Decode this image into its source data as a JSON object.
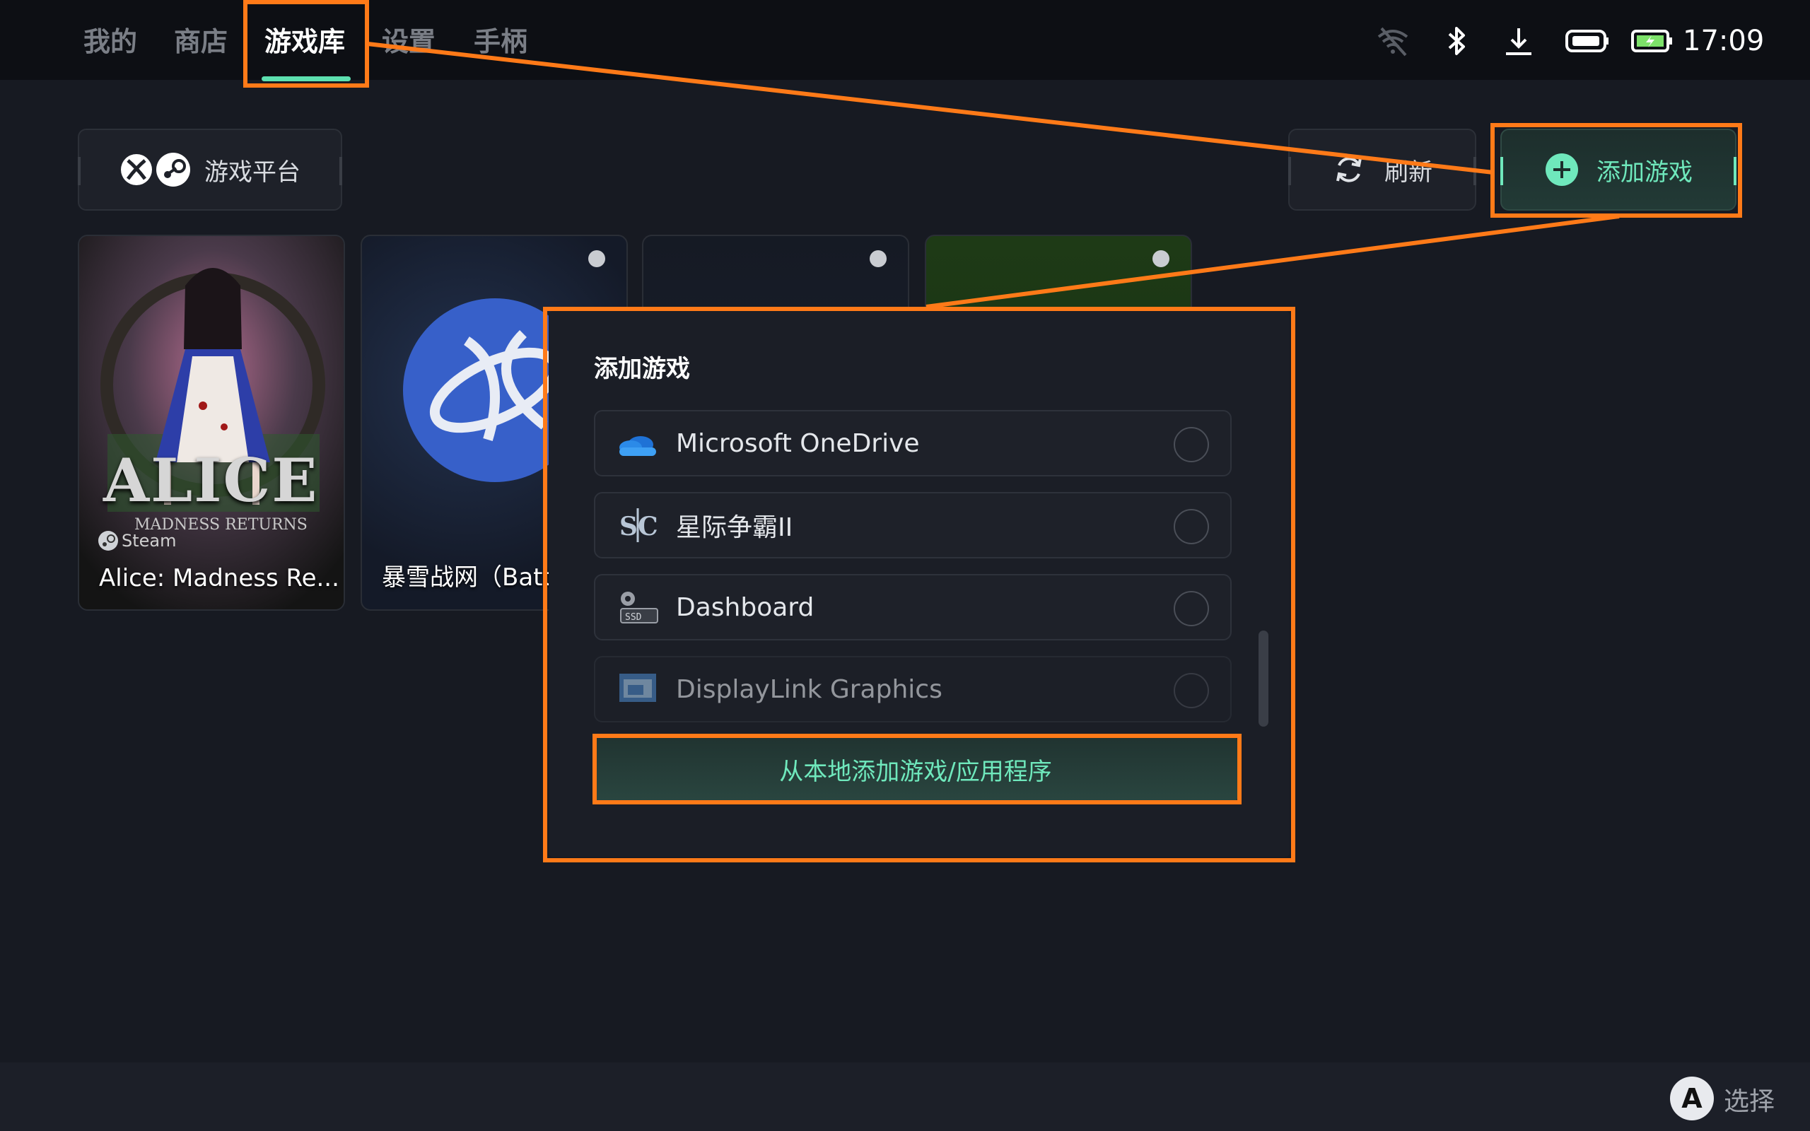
{
  "nav": {
    "tabs": [
      "我的",
      "商店",
      "游戏库",
      "设置",
      "手柄"
    ],
    "active_tab": "游戏库"
  },
  "status": {
    "icons": [
      "wifi-off-icon",
      "bluetooth-icon",
      "download-icon",
      "controller-battery-icon",
      "battery-charging-icon"
    ],
    "time": "17:09"
  },
  "toolbar": {
    "platform_label": "游戏平台",
    "refresh_label": "刷新",
    "add_game_label": "添加游戏"
  },
  "games": [
    {
      "title": "Alice: Madness Re...",
      "art_text": "ALICE",
      "art_subtext": "MADNESS RETURNS",
      "source": "Steam"
    },
    {
      "title": "暴雪战网（Battle.net）"
    },
    {
      "title": ""
    },
    {
      "title": ""
    }
  ],
  "modal": {
    "title": "添加游戏",
    "options": [
      {
        "label": "Microsoft OneDrive",
        "icon": "onedrive-icon"
      },
      {
        "label": "星际争霸II",
        "icon": "starcraft-icon"
      },
      {
        "label": "Dashboard",
        "icon": "dashboard-icon"
      },
      {
        "label": "DisplayLink Graphics",
        "icon": "displaylink-icon"
      }
    ],
    "local_add_label": "从本地添加游戏/应用程序"
  },
  "footer": {
    "a_button": "A",
    "a_action": "选择"
  },
  "colors": {
    "accent": "#6fe8bc",
    "highlight": "#ff7a18",
    "background": "#171a22"
  }
}
